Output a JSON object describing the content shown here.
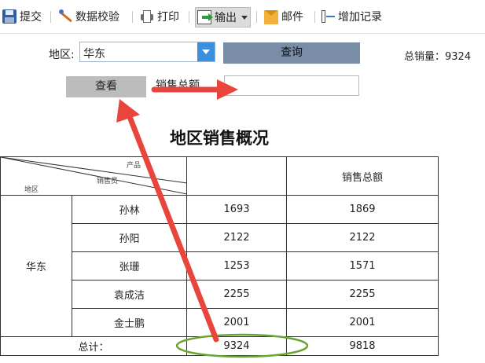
{
  "toolbar": {
    "submit": "提交",
    "validate": "数据校验",
    "print": "打印",
    "export": "输出",
    "mail": "邮件",
    "add_record": "增加记录"
  },
  "filter": {
    "region_label": "地区:",
    "region_value": "华东",
    "query_button": "查询",
    "total_sales_text": "总销量：9324",
    "view_button": "查看",
    "sum_label": "销售总额",
    "sum_value": ""
  },
  "report": {
    "title": "地区销售概况",
    "header_product": "产品",
    "header_salesperson": "销售员",
    "header_region": "地区",
    "header_col2": "",
    "header_col3": "销售总额",
    "region": "华东",
    "rows": [
      {
        "name": "孙林",
        "qty": "1693",
        "total": "1869"
      },
      {
        "name": "孙阳",
        "qty": "2122",
        "total": "2122"
      },
      {
        "name": "张珊",
        "qty": "1253",
        "total": "1571"
      },
      {
        "name": "袁成洁",
        "qty": "2255",
        "total": "2255"
      },
      {
        "name": "金士鹏",
        "qty": "2001",
        "total": "2001"
      }
    ],
    "footer_label": "总计：",
    "footer_qty": "9324",
    "footer_total": "9818"
  },
  "colors": {
    "annotation_arrow": "#e8453c",
    "highlight_ellipse": "#6aa531",
    "dropdown": "#3b8fdc",
    "query_button": "#7a8da6"
  }
}
